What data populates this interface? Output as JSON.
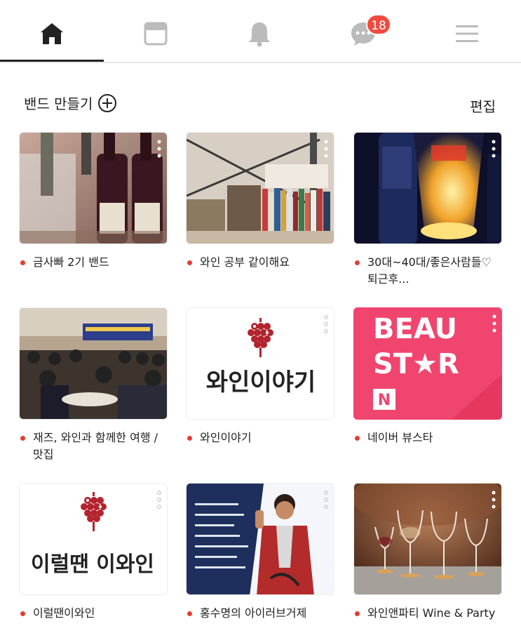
{
  "nav": {
    "tabs": [
      {
        "icon": "home-icon"
      },
      {
        "icon": "feed-icon"
      },
      {
        "icon": "bell-icon"
      },
      {
        "icon": "chat-icon",
        "badge": "18"
      },
      {
        "icon": "menu-icon"
      }
    ]
  },
  "header": {
    "make_band": "밴드 만들기",
    "edit": "편집"
  },
  "bands": [
    {
      "name": "금사빠 2기 밴드"
    },
    {
      "name": "와인 공부 같이해요"
    },
    {
      "name": "30대~40대/좋은사람들♡퇴근후..."
    },
    {
      "name": "재즈, 와인과 함께한 여행 / 맛집"
    },
    {
      "name": "와인이야기",
      "logo_text": "와인이야기"
    },
    {
      "name": "네이버 뷰스타",
      "logo_line1": "BEAU",
      "logo_line2": "ST★R",
      "logo_badge": "N"
    },
    {
      "name": "이럴땐이와인",
      "logo_text": "이럴땐 이와인"
    },
    {
      "name": "홍수명의 아이러브거제"
    },
    {
      "name": "와인앤파티 Wine & Party"
    }
  ],
  "colors": {
    "accent": "#e53d33",
    "badge": "#f04a3f",
    "beaustar": "#f0456f",
    "wine_logo": "#b3242e"
  }
}
